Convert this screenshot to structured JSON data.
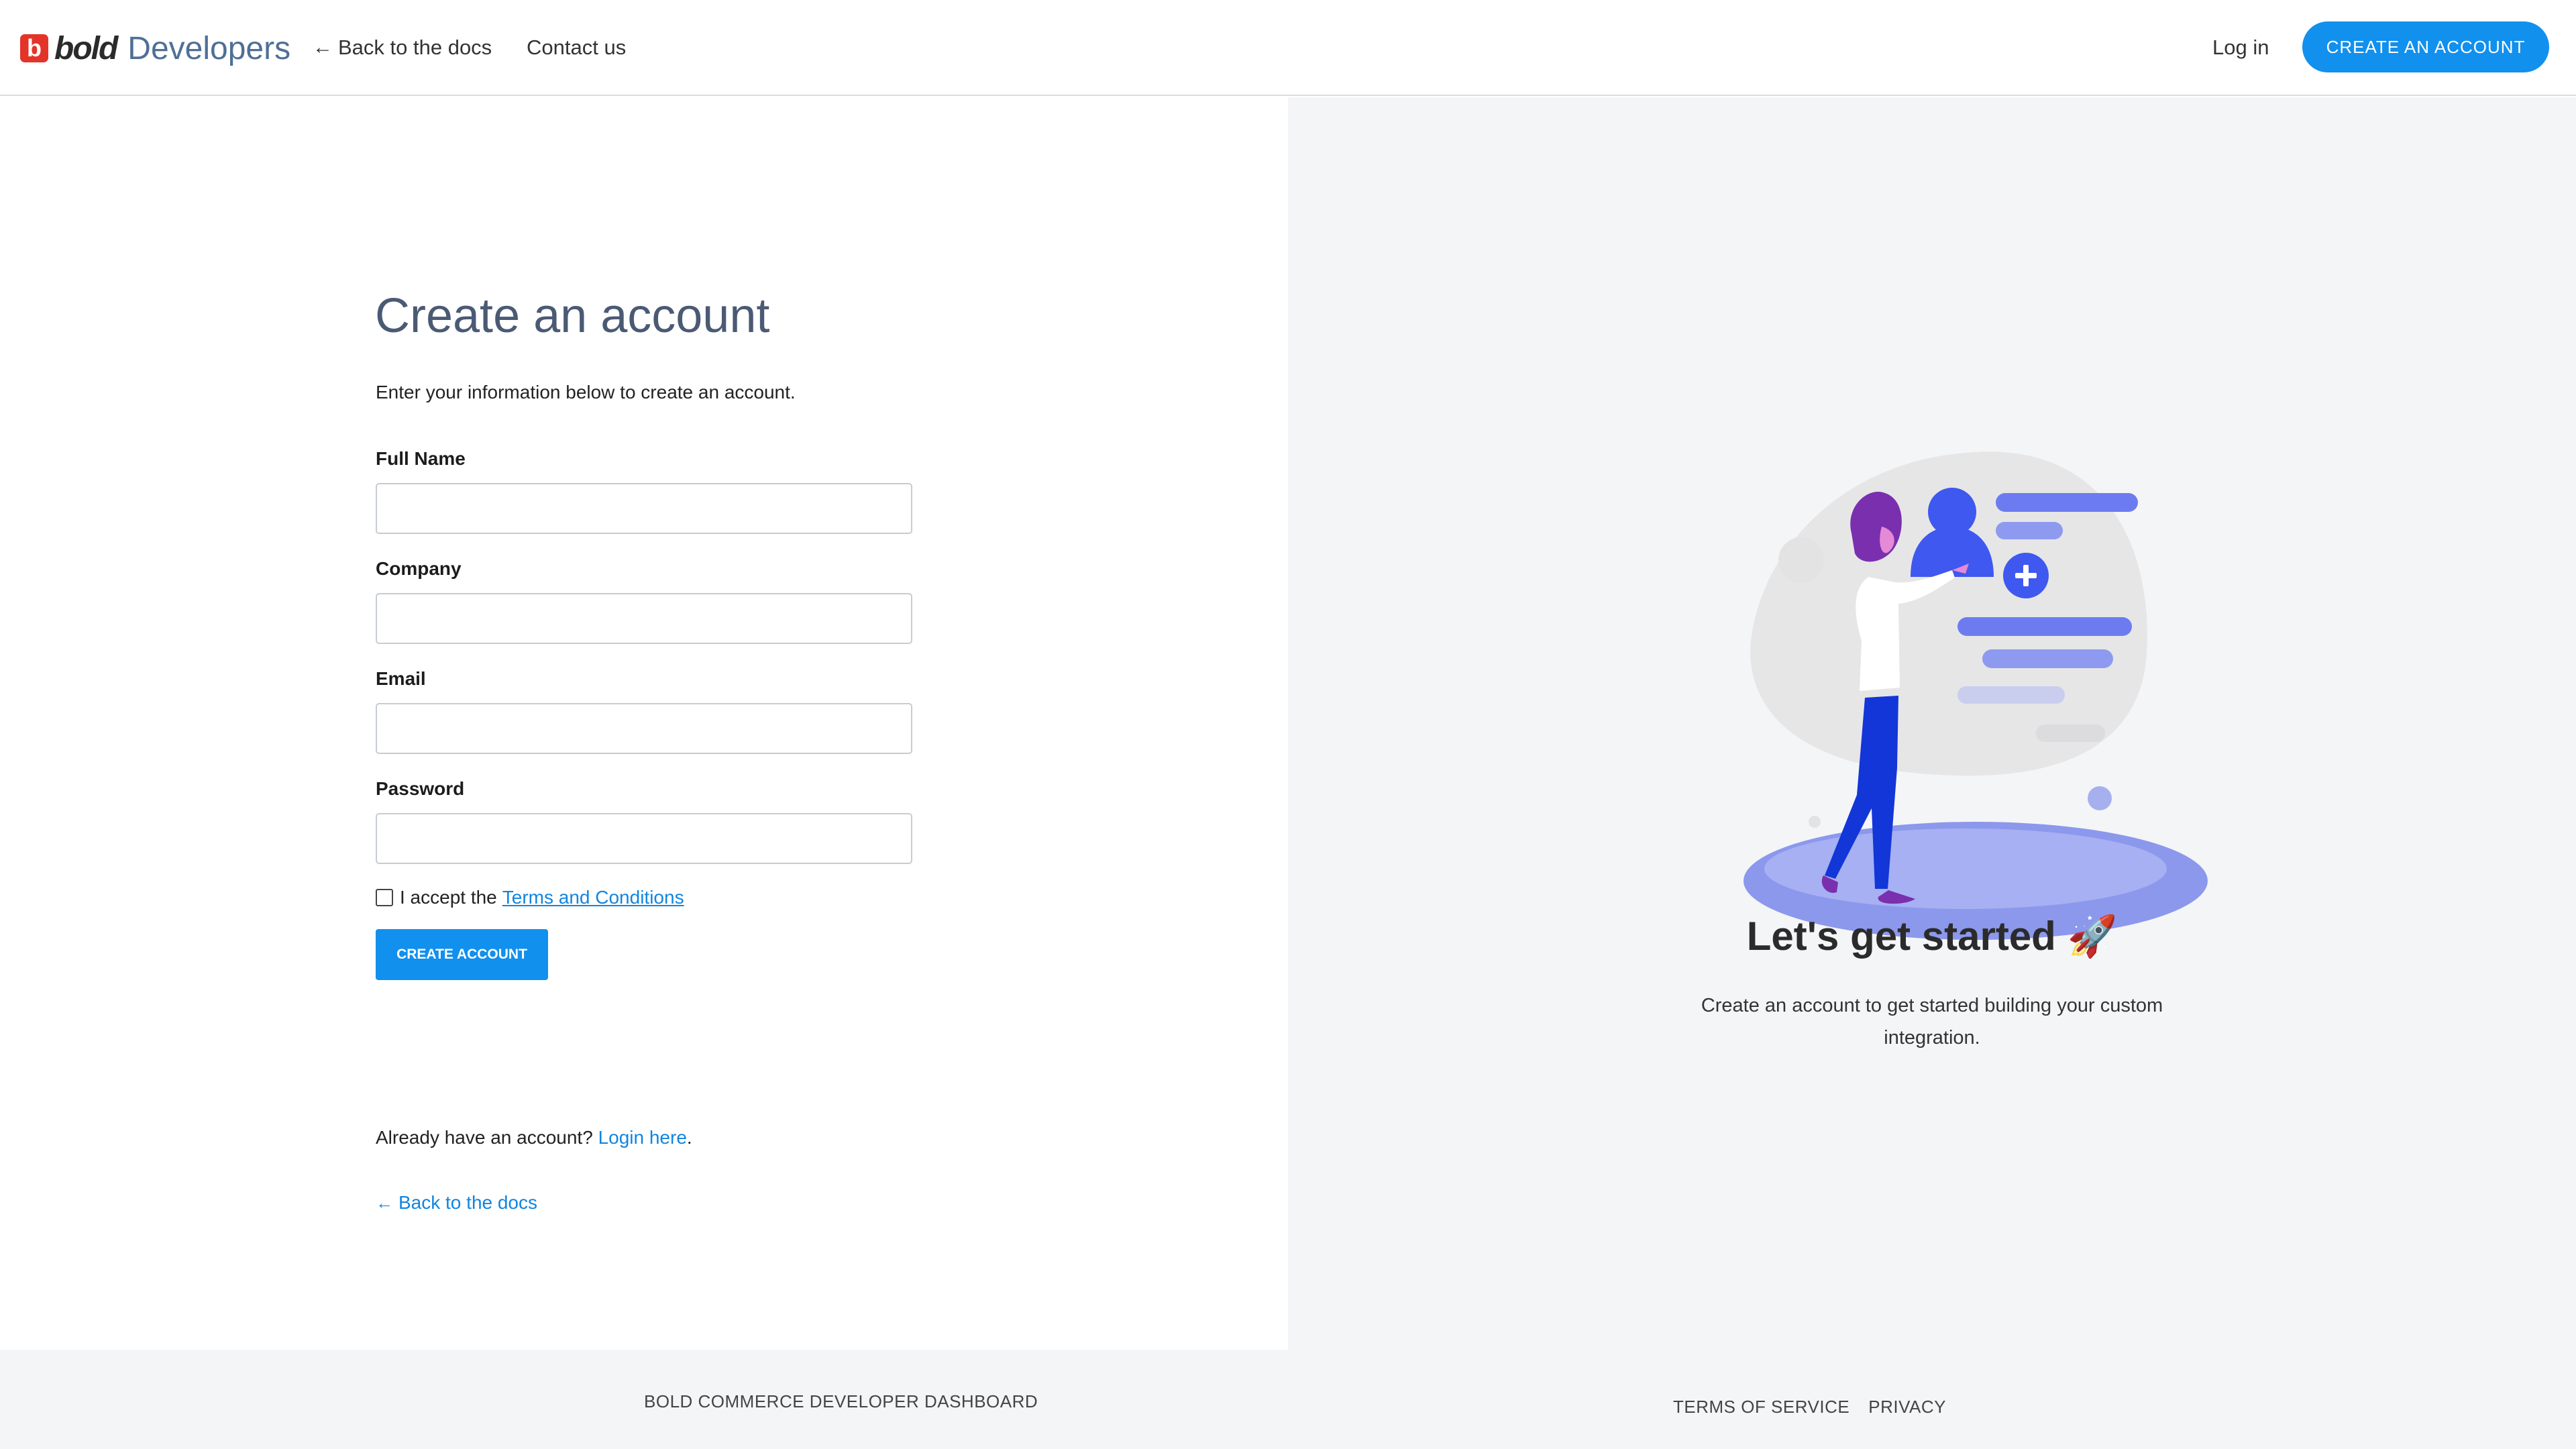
{
  "header": {
    "brand_mark": "b",
    "brand_bold": "bold",
    "brand_product": "Developers",
    "back_link": "Back to the docs",
    "contact_link": "Contact us",
    "login_link": "Log in",
    "create_button": "CREATE AN ACCOUNT"
  },
  "form": {
    "title": "Create an account",
    "subtitle": "Enter your information below to create an account.",
    "fields": [
      {
        "label": "Full Name",
        "value": "",
        "type": "text"
      },
      {
        "label": "Company",
        "value": "",
        "type": "text"
      },
      {
        "label": "Email",
        "value": "",
        "type": "email"
      },
      {
        "label": "Password",
        "value": "",
        "type": "password"
      }
    ],
    "terms_prefix": "I accept the",
    "terms_link": "Terms and Conditions",
    "terms_checked": false,
    "submit_label": "CREATE ACCOUNT",
    "already_prefix": "Already have an account?",
    "login_link": "Login here",
    "already_suffix": ".",
    "back_link": "Back to the docs"
  },
  "promo": {
    "title": "Let's get started 🚀",
    "description": "Create an account to get started building your custom integration."
  },
  "footer": {
    "left": "BOLD COMMERCE DEVELOPER DASHBOARD",
    "terms": "TERMS OF SERVICE",
    "privacy": "PRIVACY"
  },
  "colors": {
    "accent": "#1190ee",
    "link": "#1185e0",
    "brand_red": "#e4342a",
    "title": "#4b5a74",
    "panel_bg": "#f4f5f7"
  }
}
